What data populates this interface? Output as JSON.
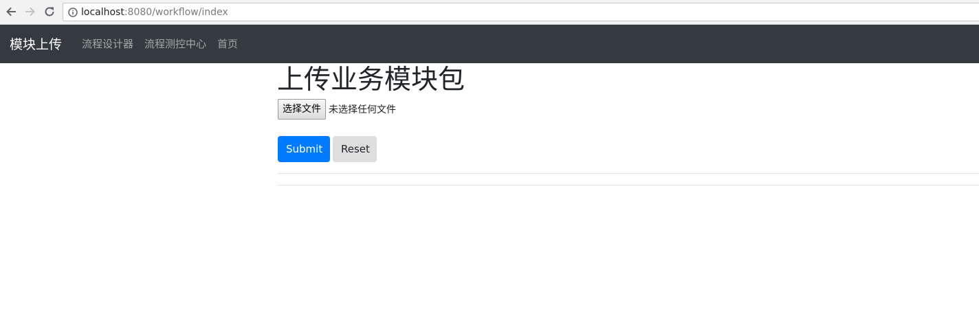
{
  "browser": {
    "url_host": "localhost",
    "url_path": ":8080/workflow/index"
  },
  "navbar": {
    "brand": "模块上传",
    "links": [
      "流程设计器",
      "流程测控中心",
      "首页"
    ]
  },
  "main": {
    "title": "上传业务模块包",
    "file_button_label": "选择文件",
    "file_status": "未选择任何文件",
    "submit_label": "Submit",
    "reset_label": "Reset"
  },
  "colors": {
    "navbar_bg": "#343a40",
    "primary": "#007bff"
  },
  "icons": {
    "back": "arrow-left-icon",
    "forward": "arrow-right-icon",
    "reload": "reload-icon",
    "info": "info-icon"
  }
}
